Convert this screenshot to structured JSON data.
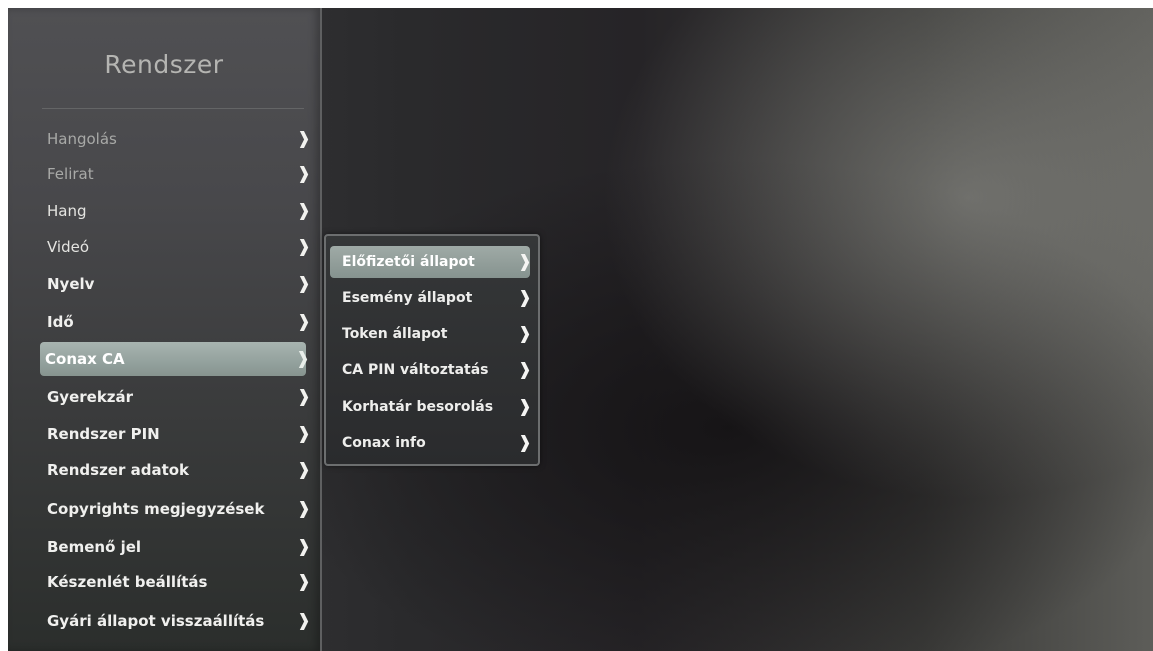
{
  "sidebar": {
    "title": "Rendszer",
    "items": [
      {
        "label": "Hangolás",
        "arrow": "❱"
      },
      {
        "label": "Felirat",
        "arrow": "❱"
      },
      {
        "label": "Hang",
        "arrow": "❱"
      },
      {
        "label": "Videó",
        "arrow": "❱"
      },
      {
        "label": "Nyelv",
        "arrow": "❱"
      },
      {
        "label": "Idő",
        "arrow": "❱"
      },
      {
        "label": "Conax CA",
        "arrow": "❱",
        "selected": true
      },
      {
        "label": "Gyerekzár",
        "arrow": "❱"
      },
      {
        "label": "Rendszer PIN",
        "arrow": "❱"
      },
      {
        "label": "Rendszer adatok",
        "arrow": "❱"
      },
      {
        "label": "Copyrights megjegyzések",
        "arrow": "❱"
      },
      {
        "label": "Bemenő jel",
        "arrow": "❱"
      },
      {
        "label": "Készenlét beállítás",
        "arrow": "❱"
      },
      {
        "label": "Gyári állapot visszaállítás",
        "arrow": "❱"
      }
    ]
  },
  "submenu": {
    "items": [
      {
        "label": "Előfizetői állapot",
        "arrow": "❱",
        "selected": true
      },
      {
        "label": "Esemény állapot",
        "arrow": "❱"
      },
      {
        "label": "Token állapot",
        "arrow": "❱"
      },
      {
        "label": "CA PIN változtatás",
        "arrow": "❱"
      },
      {
        "label": "Korhatár besorolás",
        "arrow": "❱"
      },
      {
        "label": "Conax info",
        "arrow": "❱"
      }
    ]
  },
  "colors": {
    "selection_highlight": "#93a19d",
    "menu_background": "#48484b",
    "text": "#e4e4e1"
  }
}
